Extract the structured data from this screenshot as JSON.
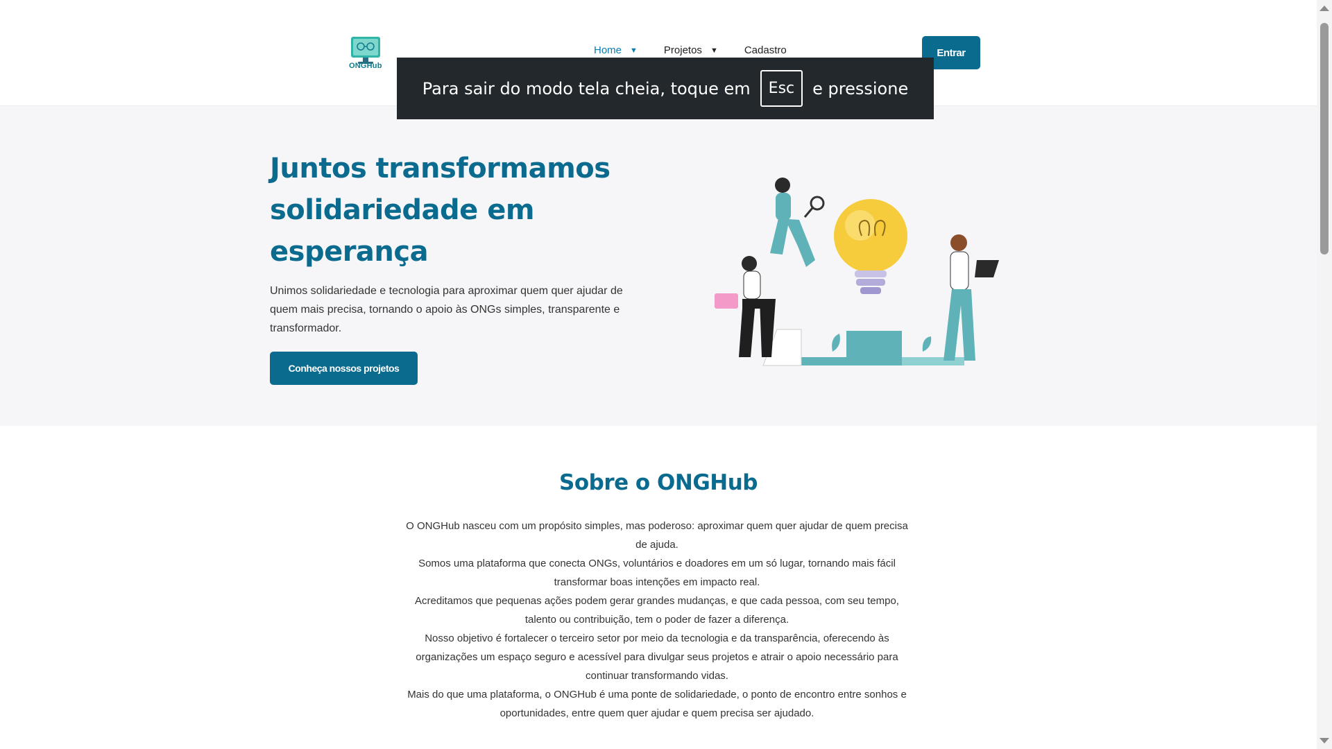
{
  "header": {
    "logo_text": "ONGHub",
    "nav": [
      {
        "label": "Home",
        "active": true,
        "dropdown": true
      },
      {
        "label": "Projetos",
        "active": false,
        "dropdown": true
      },
      {
        "label": "Cadastro",
        "active": false,
        "dropdown": false
      }
    ],
    "login_label": "Entrar"
  },
  "fullscreen_notice": {
    "before": "Para sair do modo tela cheia, toque em",
    "key": "Esc",
    "after": "e pressione"
  },
  "hero": {
    "title": "Juntos transformamos solidariedade em esperança",
    "subtitle": "Unimos solidariedade e tecnologia para aproximar quem quer ajudar de quem mais precisa, tornando o apoio às ONGs simples, transparente e transformador.",
    "cta_label": "Conheça nossos projetos"
  },
  "about": {
    "title": "Sobre o ONGHub",
    "paragraphs": [
      "O ONGHub nasceu com um propósito simples, mas poderoso: aproximar quem quer ajudar de quem precisa de ajuda.",
      "Somos uma plataforma que conecta ONGs, voluntários e doadores em um só lugar, tornando mais fácil transformar boas intenções em impacto real.",
      "Acreditamos que pequenas ações podem gerar grandes mudanças, e que cada pessoa, com seu tempo, talento ou contribuição, tem o poder de fazer a diferença.",
      "Nosso objetivo é fortalecer o terceiro setor por meio da tecnologia e da transparência, oferecendo às organizações um espaço seguro e acessível para divulgar seus projetos e atrair o apoio necessário para continuar transformando vidas.",
      "Mais do que uma plataforma, o ONGHub é uma ponte de solidariedade, o ponto de encontro entre sonhos e oportunidades, entre quem quer ajudar e quem precisa ser ajudado."
    ]
  },
  "colors": {
    "brand": "#0b6b8f",
    "nav_active": "#0a7db0",
    "hero_bg": "#f6f6f8",
    "notice_bg": "#23282c"
  }
}
